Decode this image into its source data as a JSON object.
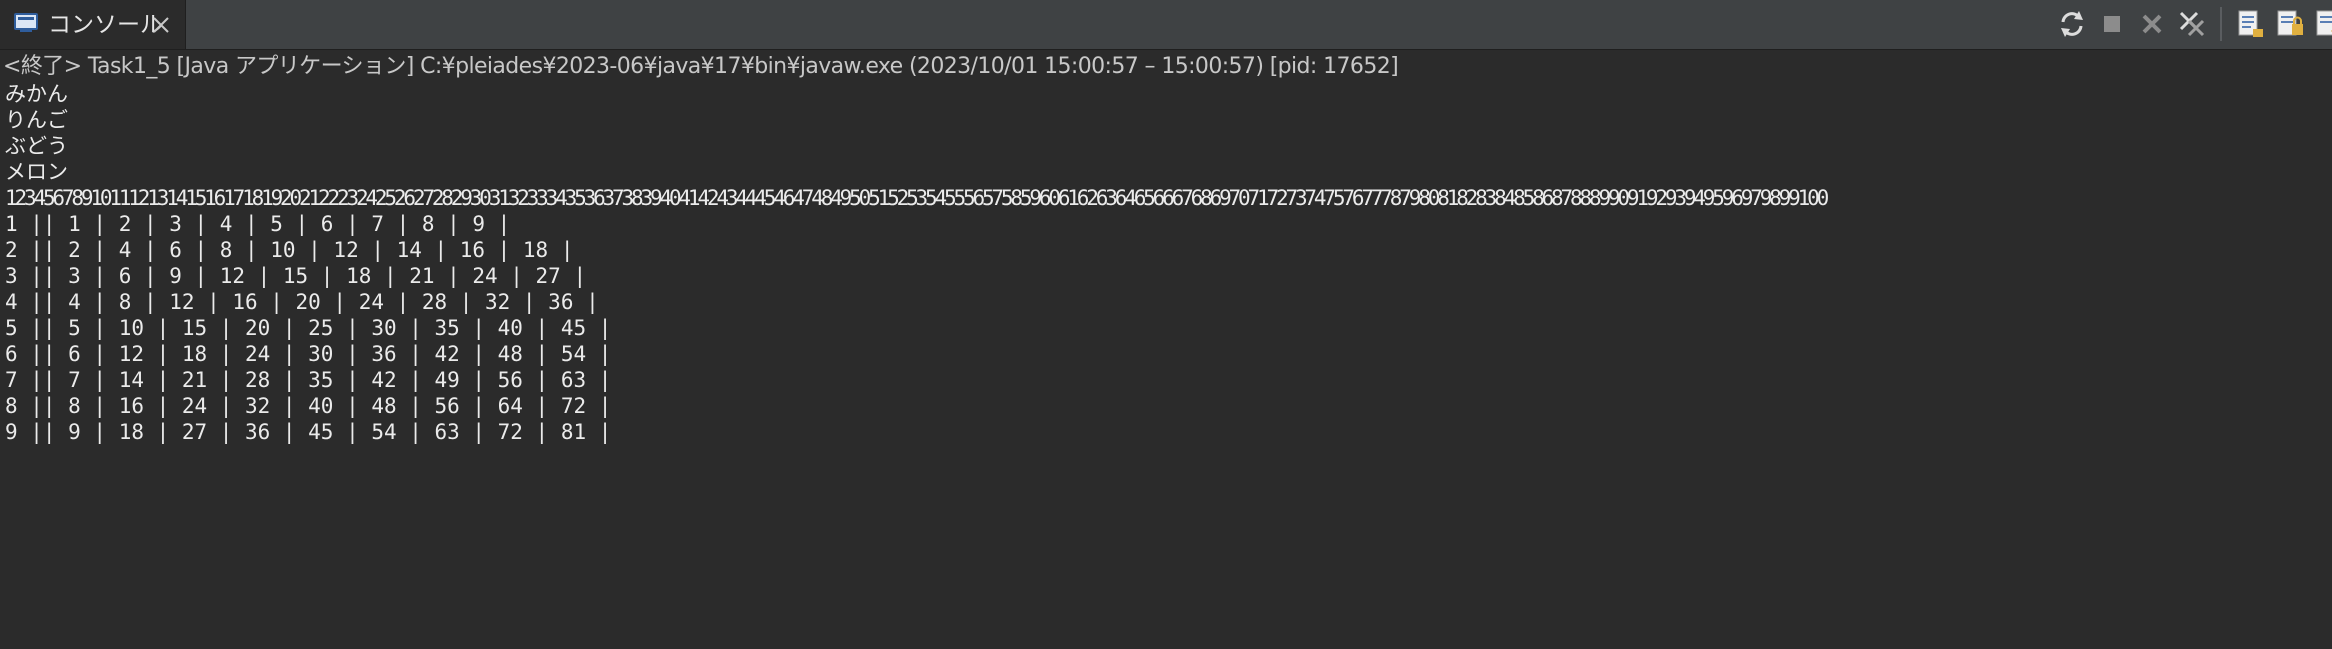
{
  "tab": {
    "title": "コンソール",
    "icon": "console-icon",
    "close_icon": "close-icon"
  },
  "toolbar": {
    "buttons": [
      {
        "name": "refresh-icon"
      },
      {
        "name": "terminate-icon"
      },
      {
        "name": "remove-launch-icon"
      },
      {
        "name": "remove-all-terminated-icon"
      },
      {
        "name": "clear-console-icon"
      },
      {
        "name": "scroll-lock-icon"
      },
      {
        "name": "word-wrap-icon"
      }
    ]
  },
  "status_line": "<終了> Task1_5 [Java アプリケーション] C:¥pleiades¥2023-06¥java¥17¥bin¥javaw.exe  (2023/10/01 15:00:57 – 15:00:57) [pid: 17652]",
  "console_lines": [
    "みかん",
    "りんご",
    "ぶどう",
    "メロン",
    "123456789101112131415161718192021222324252627282930313233343536373839404142434445464748495051525354555657585960616263646566676869707172737475767778798081828384858687888990919293949596979899100",
    "1 || 1 | 2 | 3 | 4 | 5 | 6 | 7 | 8 | 9 |",
    "2 || 2 | 4 | 6 | 8 | 10 | 12 | 14 | 16 | 18 |",
    "3 || 3 | 6 | 9 | 12 | 15 | 18 | 21 | 24 | 27 |",
    "4 || 4 | 8 | 12 | 16 | 20 | 24 | 28 | 32 | 36 |",
    "5 || 5 | 10 | 15 | 20 | 25 | 30 | 35 | 40 | 45 |",
    "6 || 6 | 12 | 18 | 24 | 30 | 36 | 42 | 48 | 54 |",
    "7 || 7 | 14 | 21 | 28 | 35 | 42 | 49 | 56 | 63 |",
    "8 || 8 | 16 | 24 | 32 | 40 | 48 | 56 | 64 | 72 |",
    "9 || 9 | 18 | 27 | 36 | 45 | 54 | 63 | 72 | 81 |"
  ],
  "colors": {
    "background": "#2b2b2b",
    "tabbar": "#3f4244",
    "text": "#ebebeb"
  }
}
